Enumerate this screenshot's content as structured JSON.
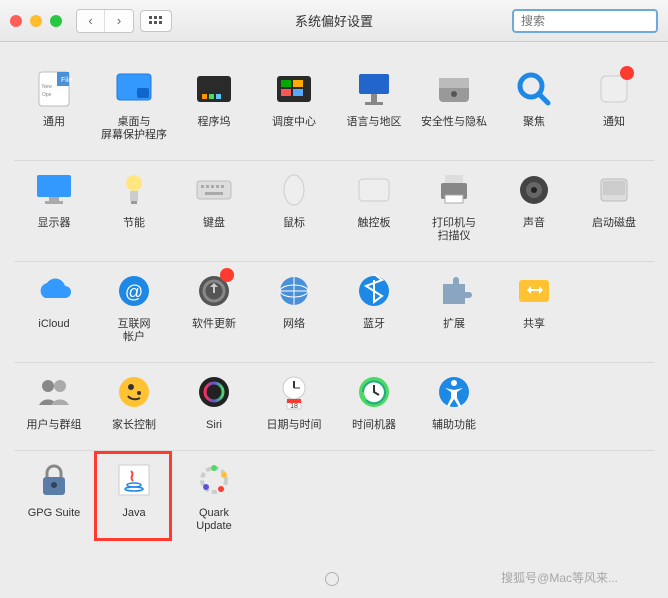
{
  "window": {
    "title": "系统偏好设置",
    "search_placeholder": "搜索"
  },
  "rows": [
    [
      {
        "name": "general",
        "label": "通用"
      },
      {
        "name": "desktop",
        "label": "桌面与\n屏幕保护程序"
      },
      {
        "name": "dock",
        "label": "程序坞"
      },
      {
        "name": "mission-control",
        "label": "调度中心"
      },
      {
        "name": "language",
        "label": "语言与地区"
      },
      {
        "name": "security",
        "label": "安全性与隐私"
      },
      {
        "name": "spotlight",
        "label": "聚焦"
      },
      {
        "name": "notifications",
        "label": "通知",
        "badge": true
      }
    ],
    [
      {
        "name": "displays",
        "label": "显示器"
      },
      {
        "name": "energy",
        "label": "节能"
      },
      {
        "name": "keyboard",
        "label": "键盘"
      },
      {
        "name": "mouse",
        "label": "鼠标"
      },
      {
        "name": "trackpad",
        "label": "触控板"
      },
      {
        "name": "printers",
        "label": "打印机与\n扫描仪"
      },
      {
        "name": "sound",
        "label": "声音"
      },
      {
        "name": "startup",
        "label": "启动磁盘"
      }
    ],
    [
      {
        "name": "icloud",
        "label": "iCloud"
      },
      {
        "name": "internet",
        "label": "互联网\n帐户"
      },
      {
        "name": "software-update",
        "label": "软件更新",
        "badge": true
      },
      {
        "name": "network",
        "label": "网络"
      },
      {
        "name": "bluetooth",
        "label": "蓝牙"
      },
      {
        "name": "extensions",
        "label": "扩展"
      },
      {
        "name": "sharing",
        "label": "共享"
      }
    ],
    [
      {
        "name": "users",
        "label": "用户与群组"
      },
      {
        "name": "parental",
        "label": "家长控制"
      },
      {
        "name": "siri",
        "label": "Siri"
      },
      {
        "name": "datetime",
        "label": "日期与时间"
      },
      {
        "name": "timemachine",
        "label": "时间机器"
      },
      {
        "name": "accessibility",
        "label": "辅助功能"
      }
    ],
    [
      {
        "name": "gpgsuite",
        "label": "GPG Suite"
      },
      {
        "name": "java",
        "label": "Java",
        "highlight": true
      },
      {
        "name": "quark",
        "label": "Quark\nUpdate"
      }
    ]
  ],
  "watermark": "搜狐号@Mac等风来..."
}
